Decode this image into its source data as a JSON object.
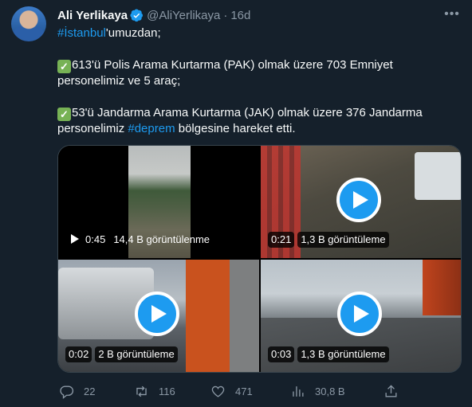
{
  "author": {
    "name": "Ali Yerlikaya",
    "handle": "@AliYerlikaya",
    "separator": "·",
    "time": "16d",
    "verified_icon": "verified-badge-icon",
    "avatar_icon": "profile-avatar"
  },
  "tweet": {
    "line1_hashtag": "#İstanbul",
    "line1_rest": "'umuzdan;",
    "para2_check": "✓",
    "para2_text": "613'ü Polis Arama Kurtarma (PAK) olmak üzere 703 Emniyet personelimiz ve 5 araç;",
    "para3_check": "✓",
    "para3_text_a": "53'ü Jandarma Arama Kurtarma (JAK) olmak üzere 376 Jandarma personelimiz ",
    "para3_hashtag": "#deprem",
    "para3_text_b": " bölgesine hareket etti."
  },
  "videos": [
    {
      "duration": "0:45",
      "views": "14,4 B görüntülenme"
    },
    {
      "duration": "0:21",
      "views": "1,3 B görüntüleme"
    },
    {
      "duration": "0:02",
      "views": "2 B görüntüleme"
    },
    {
      "duration": "0:03",
      "views": "1,3 B görüntüleme"
    }
  ],
  "actions": {
    "replies": "22",
    "retweets": "116",
    "likes": "471",
    "views": "30,8 B"
  },
  "colors": {
    "background": "#15202b",
    "accent": "#1d9bf0",
    "muted": "#8b98a5",
    "text": "#f7f9f9"
  }
}
